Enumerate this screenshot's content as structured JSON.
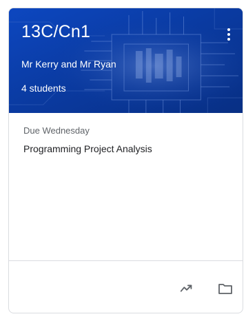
{
  "card": {
    "class_name": "13C/Cn1",
    "teachers": "Mr Kerry and Mr Ryan",
    "student_count": "4 students",
    "banner_color": "#0b3ea8",
    "icons": {
      "menu": "more-vert-icon",
      "trend": "trending-up-icon",
      "folder": "folder-icon"
    }
  },
  "assignment": {
    "due": "Due Wednesday",
    "title": "Programming Project Analysis"
  }
}
